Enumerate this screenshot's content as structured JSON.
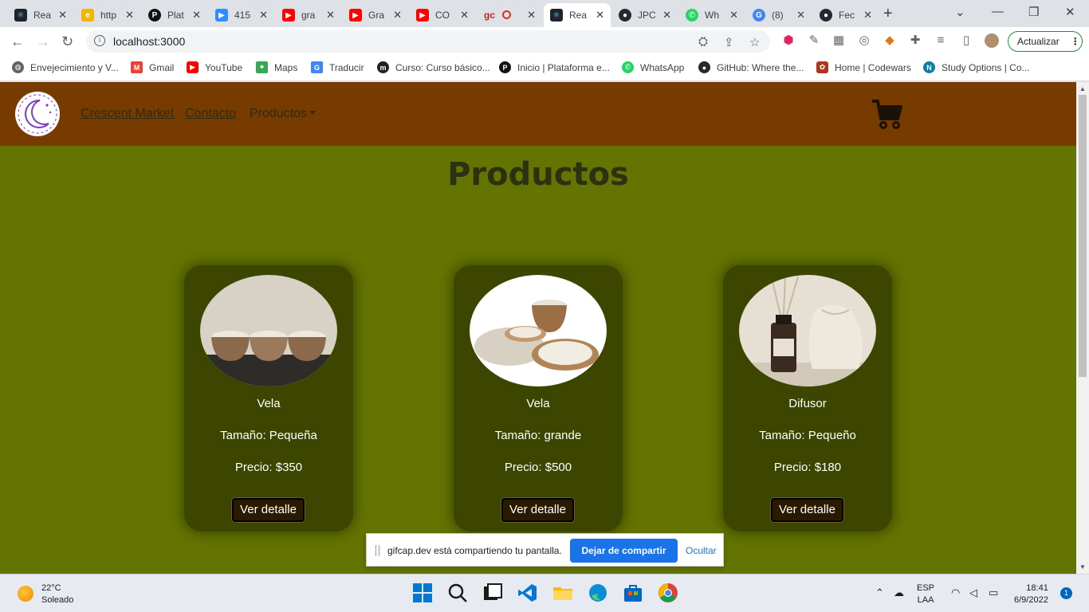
{
  "browser": {
    "tabs": [
      {
        "title": "Rea",
        "favicon": "react-icon",
        "color": "#222"
      },
      {
        "title": "http",
        "favicon": "ie-icon",
        "color": "#f4b400"
      },
      {
        "title": "Plat",
        "favicon": "platzi-icon",
        "color": "#121212"
      },
      {
        "title": "415",
        "favicon": "zoom-icon",
        "color": "#2d8cff"
      },
      {
        "title": "gra",
        "favicon": "youtube-icon",
        "color": "#ff0000"
      },
      {
        "title": "Gra",
        "favicon": "youtube-icon",
        "color": "#ff0000"
      },
      {
        "title": "CO",
        "favicon": "youtube-icon",
        "color": "#ff0000"
      },
      {
        "title": "gc",
        "favicon": "gc-icon",
        "color": "#c5221f"
      },
      {
        "title": "Rea",
        "favicon": "react-icon",
        "color": "#222"
      },
      {
        "title": "JPC",
        "favicon": "github-icon",
        "color": "#24292f"
      },
      {
        "title": "Wh",
        "favicon": "whatsapp-icon",
        "color": "#25d366"
      },
      {
        "title": "(8)",
        "favicon": "gmail-icon",
        "color": "#4285f4"
      },
      {
        "title": "Fec",
        "favicon": "github-icon",
        "color": "#24292f"
      }
    ],
    "url": "localhost:3000",
    "update_label": "Actualizar",
    "bookmarks": [
      {
        "label": "Envejecimiento y V...",
        "color": "#5f6368"
      },
      {
        "label": "Gmail",
        "color": "#ea4335"
      },
      {
        "label": "YouTube",
        "color": "#ff0000"
      },
      {
        "label": "Maps",
        "color": "#34a853"
      },
      {
        "label": "Traducir",
        "color": "#4285f4"
      },
      {
        "label": "Curso: Curso básico...",
        "color": "#202124"
      },
      {
        "label": "Inicio | Plataforma e...",
        "color": "#121212"
      },
      {
        "label": "WhatsApp",
        "color": "#25d366"
      },
      {
        "label": "GitHub: Where the...",
        "color": "#24292f"
      },
      {
        "label": "Home | Codewars",
        "color": "#b1361e"
      },
      {
        "label": "Study Options | Co...",
        "color": "#0a7fa8"
      }
    ]
  },
  "site": {
    "nav": {
      "brand": "Crescent Market",
      "contact": "Contacto",
      "products": "Productos"
    },
    "title": "Productos",
    "products": [
      {
        "name": "Vela",
        "size": "Tamaño: Pequeña",
        "price": "Precio: $350",
        "button": "Ver detalle"
      },
      {
        "name": "Vela",
        "size": "Tamaño: grande",
        "price": "Precio: $500",
        "button": "Ver detalle"
      },
      {
        "name": "Difusor",
        "size": "Tamaño: Pequeño",
        "price": "Precio: $180",
        "button": "Ver detalle"
      }
    ],
    "colors": {
      "nav": "#773b00",
      "page": "#647400",
      "card": "#3c4600"
    }
  },
  "share_bar": {
    "message": "gifcap.dev está compartiendo tu pantalla.",
    "stop_label": "Dejar de compartir",
    "hide_label": "Ocultar"
  },
  "taskbar": {
    "temperature": "22°C",
    "condition": "Soleado",
    "lang_top": "ESP",
    "lang_bottom": "LAA",
    "time": "18:41",
    "date": "6/9/2022",
    "notifications": "1"
  }
}
